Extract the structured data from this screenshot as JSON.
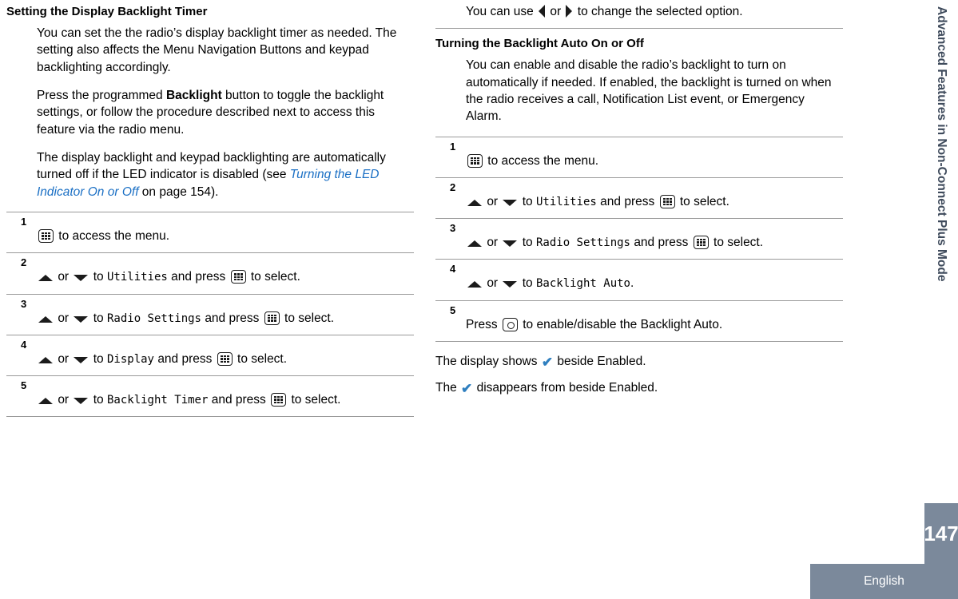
{
  "left_column": {
    "section_title": "Setting the Display Backlight Timer",
    "paragraph_1": "You can set the the radio’s display backlight timer as needed. The setting also affects the Menu Navigation Buttons and keypad backlighting accordingly.",
    "paragraph_2_pre": "Press the programmed ",
    "paragraph_2_bold": "Backlight",
    "paragraph_2_post": " button to toggle the backlight settings, or follow the procedure described next to access this feature via the radio menu.",
    "paragraph_3_pre": "The display backlight and keypad backlighting are automatically turned off if the LED indicator is disabled (see ",
    "paragraph_3_link": "Turning the LED Indicator On or Off",
    "paragraph_3_post": " on page 154).",
    "steps": [
      {
        "num": "1",
        "text_after_icon": " to access the menu."
      },
      {
        "num": "2",
        "or_text": "or",
        "to_text": "to",
        "menu": "Utilities",
        "and_press": "and press",
        "to_select": "to select."
      },
      {
        "num": "3",
        "or_text": "or",
        "to_text": "to",
        "menu": "Radio Settings",
        "and_press": "and press",
        "to_select": "to select."
      },
      {
        "num": "4",
        "or_text": "or",
        "to_text": "to",
        "menu": "Display",
        "and_press": "and press",
        "to_select": "to select."
      },
      {
        "num": "5",
        "or_text": "or",
        "to_text": "to",
        "menu": "Backlight Timer",
        "and_press": "and press",
        "to_select": "to select."
      }
    ]
  },
  "right_column": {
    "top_note_pre": "You can use ",
    "top_note_or": " or ",
    "top_note_post": " to change the selected option.",
    "section_title": "Turning the Backlight Auto On or Off",
    "paragraph_1": "You can enable and disable the radio’s backlight to turn on automatically if needed. If enabled, the backlight is turned on when the radio receives a call, Notification List event, or Emergency Alarm.",
    "steps": [
      {
        "num": "1",
        "text_after_icon": " to access the menu."
      },
      {
        "num": "2",
        "or_text": "or",
        "to_text": "to",
        "menu": "Utilities",
        "and_press": "and press",
        "to_select": "to select."
      },
      {
        "num": "3",
        "or_text": "or",
        "to_text": "to",
        "menu": "Radio Settings",
        "and_press": "and press",
        "to_select": "to select."
      },
      {
        "num": "4",
        "or_text": "or",
        "to_text": "to",
        "menu": "Backlight Auto",
        "and_press": "",
        "to_select": "."
      },
      {
        "num": "5",
        "press_text": "Press",
        "tail_text": " to enable/disable the Backlight Auto."
      }
    ],
    "result_1_pre": "The display shows ",
    "result_1_post": " beside Enabled.",
    "result_2_pre": "The ",
    "result_2_post": " disappears from beside Enabled."
  },
  "running_head": "Advanced Features in Non-Connect Plus Mode",
  "page_number": "147",
  "language": "English",
  "colors": {
    "link": "#1a6fc4",
    "side_tab_text": "#3f4b5c",
    "footer_band": "#7b899b",
    "check_mark": "#2f7fbf",
    "rule": "#9a9a9a"
  },
  "icons": {
    "menu_key": "menu-key-icon",
    "ok_key": "ok-key-icon",
    "up_arrow": "arrow-up-icon",
    "down_arrow": "arrow-down-icon",
    "left_arrow": "arrow-left-icon",
    "right_arrow": "arrow-right-icon",
    "check": "check-mark-icon"
  }
}
